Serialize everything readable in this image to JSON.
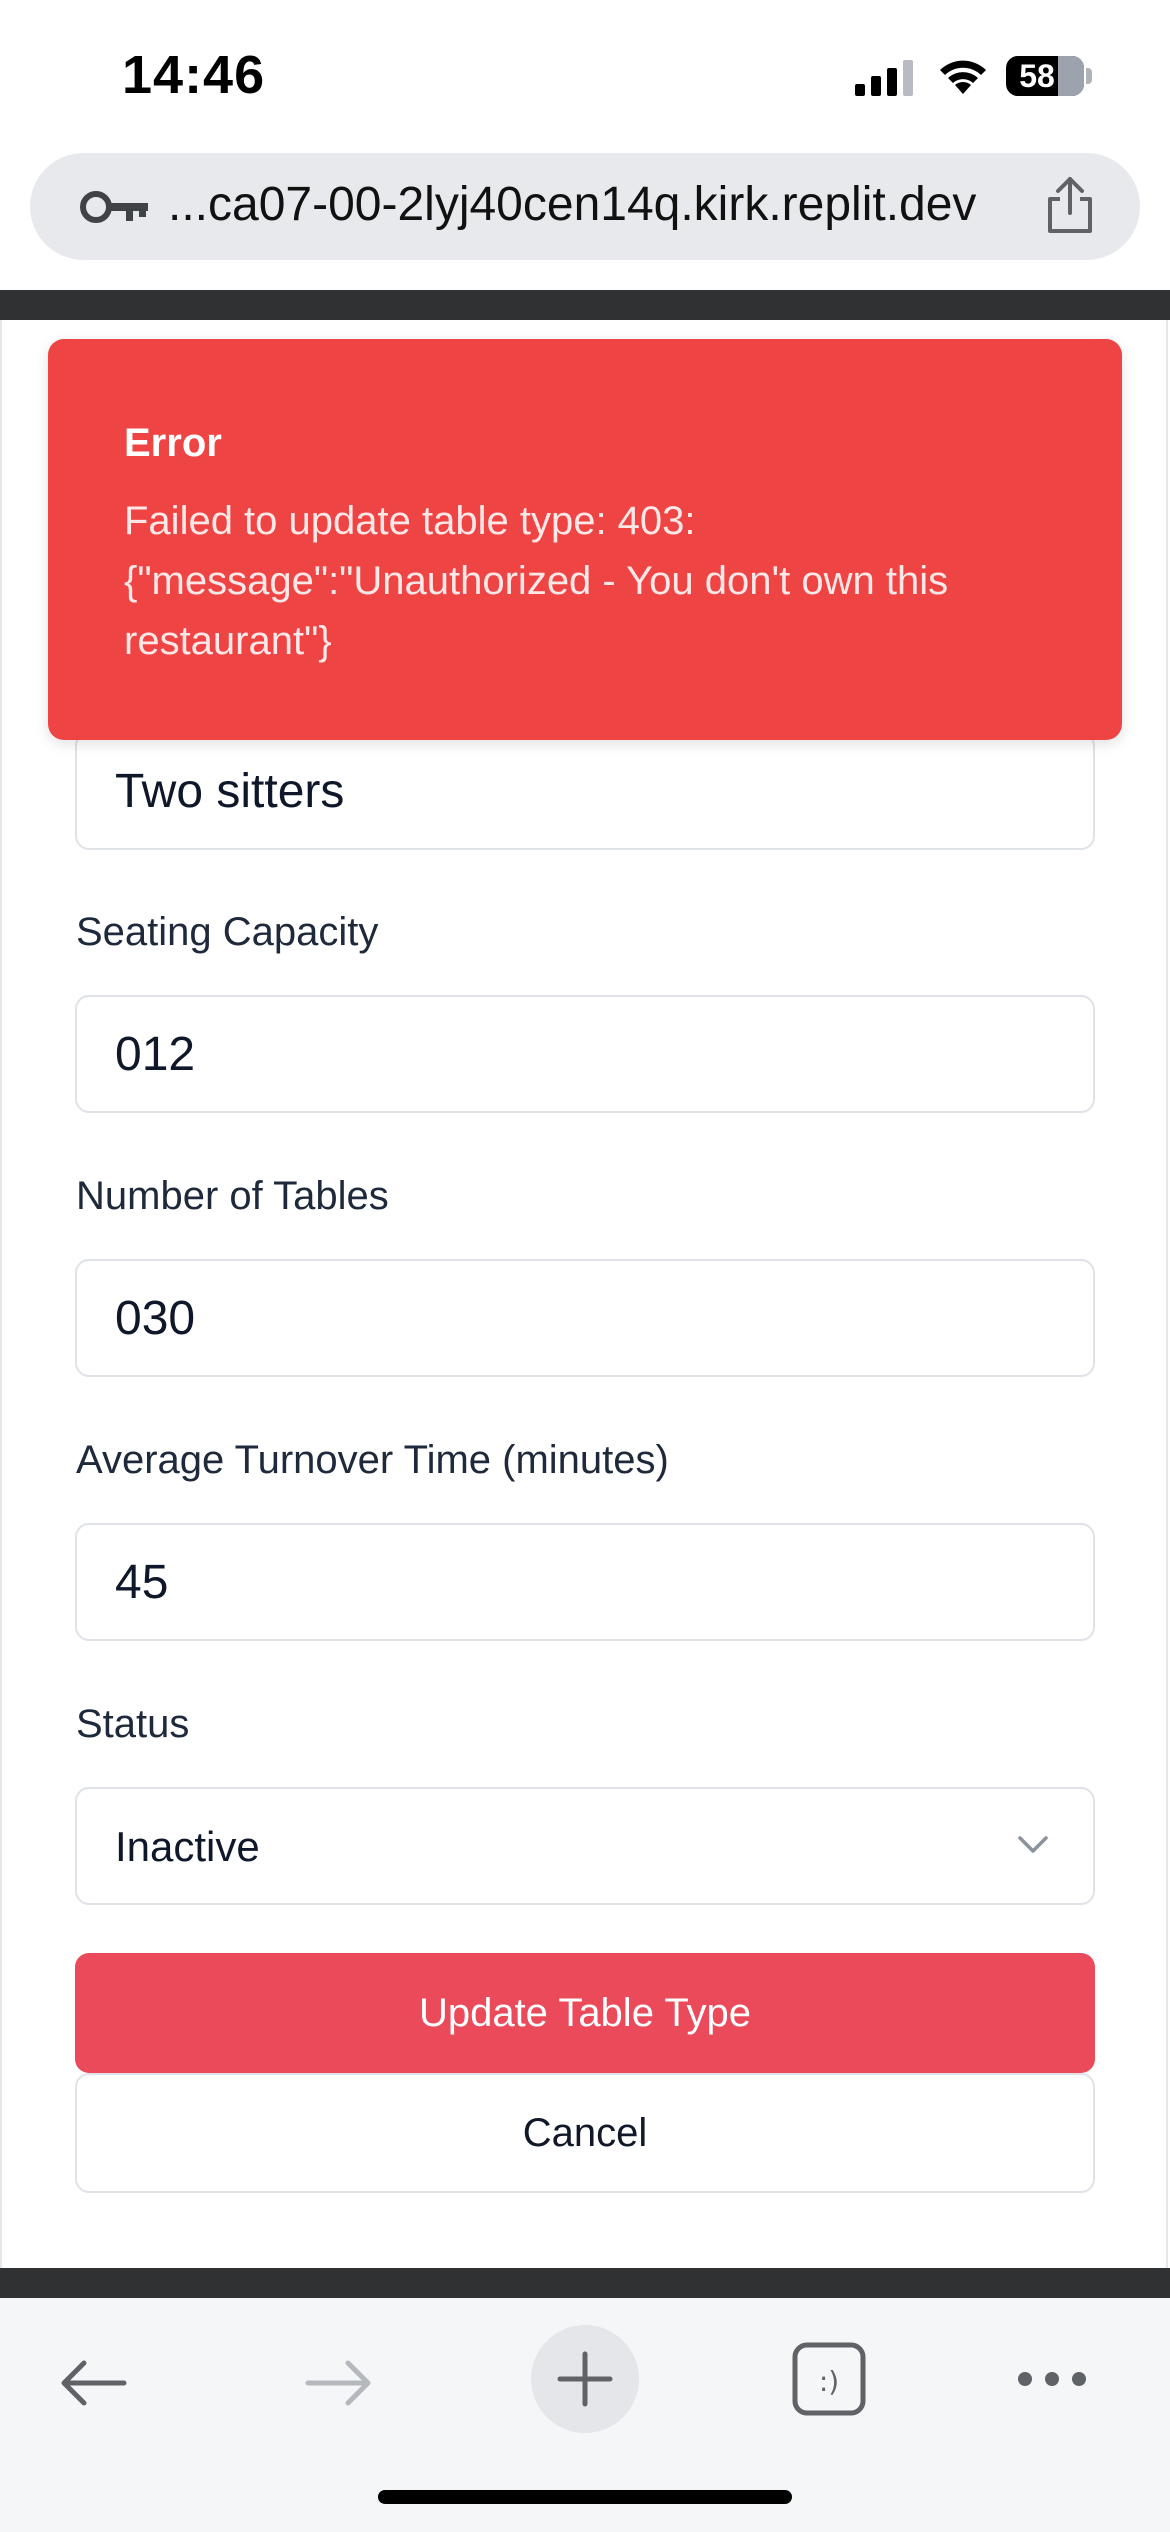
{
  "status_bar": {
    "time": "14:46",
    "battery": "58"
  },
  "browser": {
    "url": "...ca07-00-2lyj40cen14q.kirk.replit.dev"
  },
  "toast": {
    "title": "Error",
    "message": "Failed to update table type: 403: {\"message\":\"Unauthorized - You don't own this restaurant\"}"
  },
  "form": {
    "name_value": "Two sitters",
    "capacity_label": "Seating Capacity",
    "capacity_value": "012",
    "tables_label": "Number of Tables",
    "tables_value": "030",
    "turnover_label": "Average Turnover Time (minutes)",
    "turnover_value": "45",
    "status_label": "Status",
    "status_value": "Inactive",
    "submit_label": "Update Table Type",
    "cancel_label": "Cancel"
  },
  "colors": {
    "primary": "#ea4a5a",
    "error": "#ef4444"
  }
}
